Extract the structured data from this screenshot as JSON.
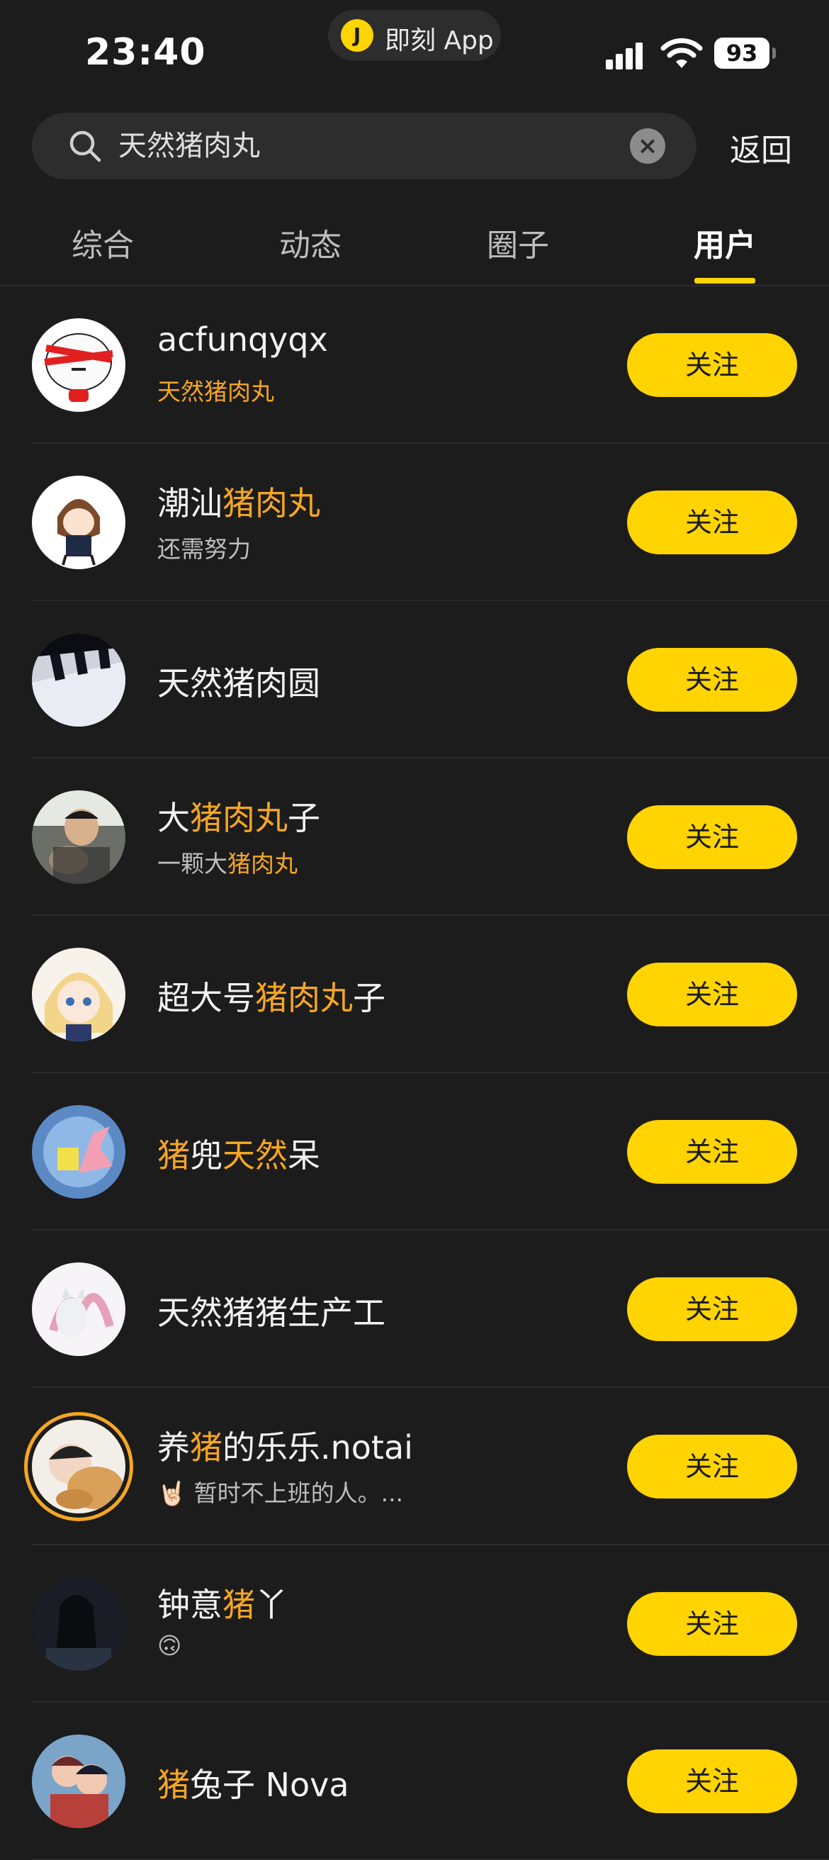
{
  "status_bar": {
    "time": "23:40",
    "app_logo_glyph": "J",
    "app_label": "即刻 App",
    "battery": "93"
  },
  "search": {
    "query": "天然猪肉丸",
    "back_label": "返回"
  },
  "tabs": [
    {
      "label": "综合"
    },
    {
      "label": "动态"
    },
    {
      "label": "圈子"
    },
    {
      "label": "用户",
      "active": true
    }
  ],
  "highlight_color": "#f5a623",
  "accent_color": "#ffd400",
  "follow_label": "关注",
  "users": [
    {
      "name": [
        {
          "t": "acfunqyqx"
        }
      ],
      "sub": [
        {
          "t": "天然猪肉丸",
          "hl": true
        }
      ],
      "avatar": "meme-face-avatar"
    },
    {
      "name": [
        {
          "t": "潮汕"
        },
        {
          "t": "猪肉丸",
          "hl": true
        }
      ],
      "sub": [
        {
          "t": "还需努力"
        }
      ],
      "avatar": "anime-girl-avatar"
    },
    {
      "name": [
        {
          "t": "天然猪肉圆"
        }
      ],
      "sub": [],
      "avatar": "piano-keys-avatar"
    },
    {
      "name": [
        {
          "t": "大"
        },
        {
          "t": "猪肉丸",
          "hl": true
        },
        {
          "t": "子"
        }
      ],
      "sub": [
        {
          "t": "一颗大"
        },
        {
          "t": "猪肉丸",
          "hl": true
        }
      ],
      "avatar": "person-with-cat-avatar"
    },
    {
      "name": [
        {
          "t": "超大号"
        },
        {
          "t": "猪肉丸",
          "hl": true
        },
        {
          "t": "子"
        }
      ],
      "sub": [],
      "avatar": "anime-blonde-avatar"
    },
    {
      "name": [
        {
          "t": "猪",
          "hl": true
        },
        {
          "t": "兜"
        },
        {
          "t": "天然",
          "hl": true
        },
        {
          "t": "呆"
        }
      ],
      "sub": [],
      "avatar": "cartoon-starfish-avatar"
    },
    {
      "name": [
        {
          "t": "天然猪猪生产工"
        }
      ],
      "sub": [],
      "avatar": "fox-illustration-avatar"
    },
    {
      "name": [
        {
          "t": "养"
        },
        {
          "t": "猪",
          "hl": true
        },
        {
          "t": "的乐乐.notai"
        }
      ],
      "sub": [
        {
          "t": "🤘🏻 暂时不上班的人。..."
        }
      ],
      "avatar": "person-with-dog-avatar",
      "ring": true
    },
    {
      "name": [
        {
          "t": "钟意"
        },
        {
          "t": "猪",
          "hl": true
        },
        {
          "t": "丫"
        }
      ],
      "sub": [
        {
          "t": "🙃"
        }
      ],
      "avatar": "dark-portrait-avatar"
    },
    {
      "name": [
        {
          "t": "猪",
          "hl": true
        },
        {
          "t": "兔子 Nova"
        }
      ],
      "sub": [],
      "avatar": "couple-illustration-avatar"
    }
  ]
}
